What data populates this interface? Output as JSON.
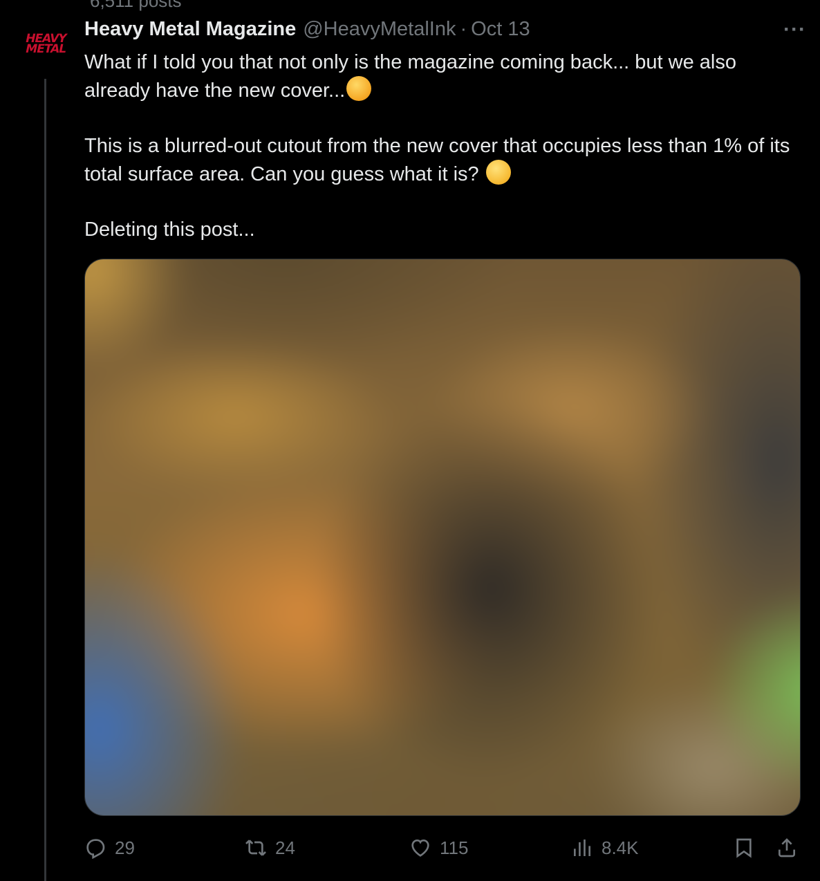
{
  "top_cut_text": "6,511 posts",
  "author": {
    "avatar_text_line1": "HEAVY",
    "avatar_text_line2": "METAL",
    "name": "Heavy Metal Magazine",
    "handle": "@HeavyMetalInk",
    "separator": "·",
    "date": "Oct 13"
  },
  "more_label": "···",
  "tweet": {
    "line1": "What if I told you that not only is the magazine coming back... but we also already have the new cover...",
    "line2": "This is a blurred-out cutout from the new cover that occupies less than 1% of its total surface area. Can you guess what it is?",
    "line3": "Deleting this post..."
  },
  "emoji": [
    "face-with-hand-over-mouth-emoji",
    "smirking-face-emoji"
  ],
  "actions": {
    "replies": "29",
    "retweets": "24",
    "likes": "115",
    "views": "8.4K"
  },
  "colors": {
    "background": "#000000",
    "text": "#e7e9ea",
    "muted": "#71767b",
    "brand_red": "#c8102e"
  }
}
